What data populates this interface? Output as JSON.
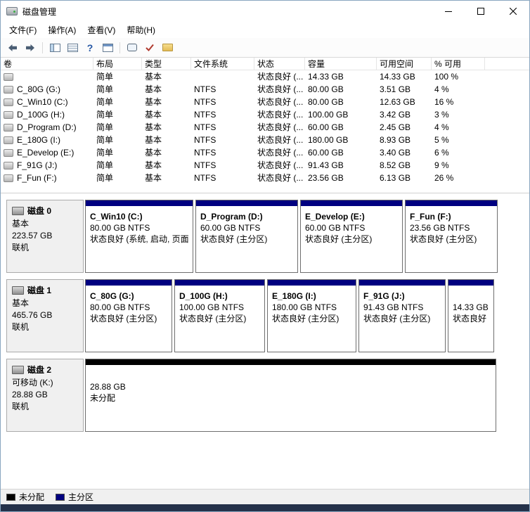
{
  "window": {
    "title": "磁盘管理"
  },
  "menu": {
    "items": [
      "文件(F)",
      "操作(A)",
      "查看(V)",
      "帮助(H)"
    ]
  },
  "toolbar": {
    "icons": [
      "back",
      "forward",
      "show-console-tree",
      "export-list",
      "help",
      "properties",
      "action-pane",
      "check",
      "folder"
    ]
  },
  "volume_list": {
    "columns": {
      "volume": "卷",
      "layout": "布局",
      "type": "类型",
      "fs": "文件系统",
      "status": "状态",
      "capacity": "容量",
      "free": "可用空间",
      "pct": "% 可用"
    },
    "rows": [
      {
        "volume": "",
        "layout": "简单",
        "type": "基本",
        "fs": "",
        "status": "状态良好 (...",
        "capacity": "14.33 GB",
        "free": "14.33 GB",
        "pct": "100 %"
      },
      {
        "volume": "C_80G (G:)",
        "layout": "简单",
        "type": "基本",
        "fs": "NTFS",
        "status": "状态良好 (...",
        "capacity": "80.00 GB",
        "free": "3.51 GB",
        "pct": "4 %"
      },
      {
        "volume": "C_Win10 (C:)",
        "layout": "简单",
        "type": "基本",
        "fs": "NTFS",
        "status": "状态良好 (...",
        "capacity": "80.00 GB",
        "free": "12.63 GB",
        "pct": "16 %"
      },
      {
        "volume": "D_100G (H:)",
        "layout": "简单",
        "type": "基本",
        "fs": "NTFS",
        "status": "状态良好 (...",
        "capacity": "100.00 GB",
        "free": "3.42 GB",
        "pct": "3 %"
      },
      {
        "volume": "D_Program (D:)",
        "layout": "简单",
        "type": "基本",
        "fs": "NTFS",
        "status": "状态良好 (...",
        "capacity": "60.00 GB",
        "free": "2.45 GB",
        "pct": "4 %"
      },
      {
        "volume": "E_180G (I:)",
        "layout": "简单",
        "type": "基本",
        "fs": "NTFS",
        "status": "状态良好 (...",
        "capacity": "180.00 GB",
        "free": "8.93 GB",
        "pct": "5 %"
      },
      {
        "volume": "E_Develop (E:)",
        "layout": "简单",
        "type": "基本",
        "fs": "NTFS",
        "status": "状态良好 (...",
        "capacity": "60.00 GB",
        "free": "3.40 GB",
        "pct": "6 %"
      },
      {
        "volume": "F_91G (J:)",
        "layout": "简单",
        "type": "基本",
        "fs": "NTFS",
        "status": "状态良好 (...",
        "capacity": "91.43 GB",
        "free": "8.52 GB",
        "pct": "9 %"
      },
      {
        "volume": "F_Fun (F:)",
        "layout": "简单",
        "type": "基本",
        "fs": "NTFS",
        "status": "状态良好 (...",
        "capacity": "23.56 GB",
        "free": "6.13 GB",
        "pct": "26 %"
      }
    ]
  },
  "disks": [
    {
      "name": "磁盘 0",
      "kind": "基本",
      "size": "223.57 GB",
      "state": "联机",
      "partitions": [
        {
          "title": "C_Win10 (C:)",
          "size": "80.00 GB NTFS",
          "status": "状态良好 (系统, 启动, 页面"
        },
        {
          "title": "D_Program (D:)",
          "size": "60.00 GB NTFS",
          "status": "状态良好 (主分区)"
        },
        {
          "title": "E_Develop (E:)",
          "size": "60.00 GB NTFS",
          "status": "状态良好 (主分区)"
        },
        {
          "title": "F_Fun (F:)",
          "size": "23.56 GB NTFS",
          "status": "状态良好 (主分区)"
        }
      ]
    },
    {
      "name": "磁盘 1",
      "kind": "基本",
      "size": "465.76 GB",
      "state": "联机",
      "partitions": [
        {
          "title": "C_80G (G:)",
          "size": "80.00 GB NTFS",
          "status": "状态良好 (主分区)"
        },
        {
          "title": "D_100G (H:)",
          "size": "100.00 GB NTFS",
          "status": "状态良好 (主分区)"
        },
        {
          "title": "E_180G (I:)",
          "size": "180.00 GB NTFS",
          "status": "状态良好 (主分区)"
        },
        {
          "title": "F_91G (J:)",
          "size": "91.43 GB NTFS",
          "status": "状态良好 (主分区)"
        },
        {
          "title": "",
          "size": "14.33 GB",
          "status": "状态良好 (恢复分..."
        }
      ]
    },
    {
      "name": "磁盘 2",
      "kind": "可移动 (K:)",
      "size": "28.88 GB",
      "state": "联机",
      "partitions": [
        {
          "title": "",
          "size": "28.88 GB",
          "status": "未分配"
        }
      ]
    }
  ],
  "legend": {
    "items": [
      {
        "label": "未分配",
        "color": "#000000"
      },
      {
        "label": "主分区",
        "color": "#000080"
      }
    ]
  },
  "colors": {
    "primary_partition": "#000080",
    "unallocated": "#000000",
    "taskbar": "#24314a"
  }
}
